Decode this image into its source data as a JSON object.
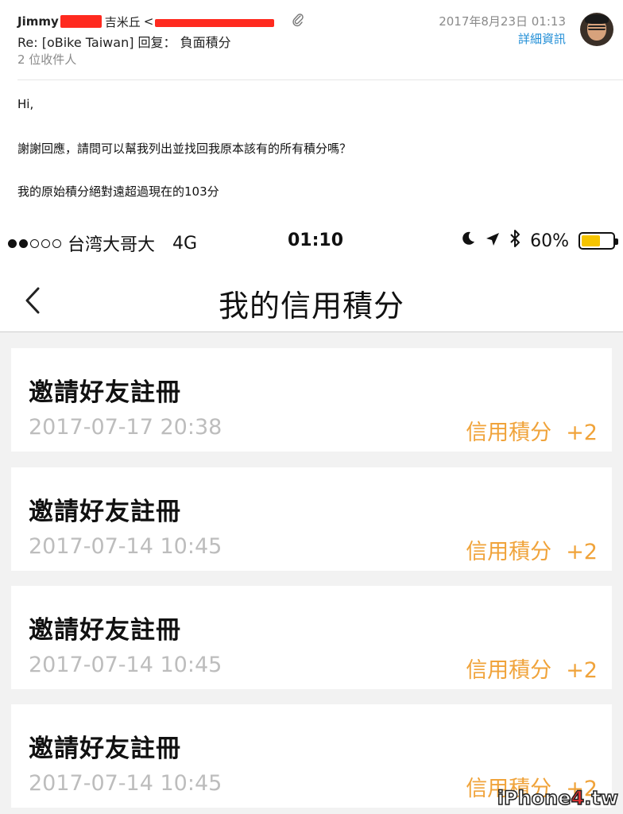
{
  "email": {
    "from_name": "Jimmy",
    "from_chinese": "吉米丘",
    "from_bracket": "<",
    "date": "2017年8月23日 01:13",
    "details_link": "詳細資訊",
    "subject": "Re: [oBike Taiwan] 回复： 負面積分",
    "recipients": "2 位收件人",
    "body": {
      "greeting": "Hi,",
      "line1": "謝謝回應，請問可以幫我列出並找回我原本該有的所有積分嗎？",
      "line2": "我的原始積分絕對遠超過現在的103分"
    },
    "redaction_color": "#ff2a1f",
    "link_color": "#1f8dd6"
  },
  "phone": {
    "status_bar": {
      "signal_dots_filled": 2,
      "signal_dots_total": 5,
      "carrier": "台湾大哥大",
      "network": "4G",
      "time": "01:10",
      "battery_percent_text": "60%",
      "battery_level": 0.6,
      "battery_color": "#f5c400"
    },
    "nav": {
      "title": "我的信用積分",
      "back_icon": "chevron-left-icon"
    },
    "list": [
      {
        "title": "邀請好友註冊",
        "time": "2017-07-17 20:38",
        "points_label": "信用積分",
        "points_value": "+2"
      },
      {
        "title": "邀請好友註冊",
        "time": "2017-07-14 10:45",
        "points_label": "信用積分",
        "points_value": "+2"
      },
      {
        "title": "邀請好友註冊",
        "time": "2017-07-14 10:45",
        "points_label": "信用積分",
        "points_value": "+2"
      },
      {
        "title": "邀請好友註冊",
        "time": "2017-07-14 10:45",
        "points_label": "信用積分",
        "points_value": "+2"
      }
    ],
    "accent_color": "#f0a33a"
  },
  "watermark": {
    "prefix": "iPhone",
    "digit": "4",
    "suffix": ".tw"
  }
}
